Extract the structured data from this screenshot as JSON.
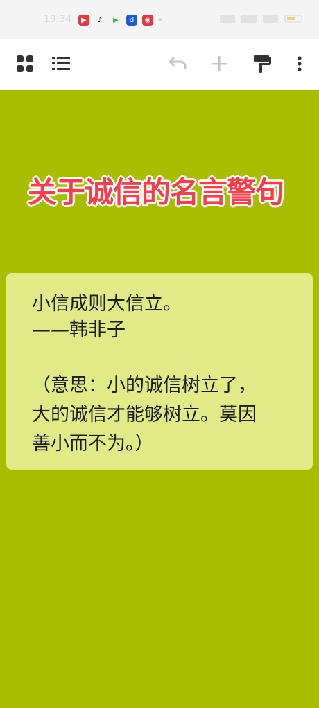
{
  "status_bar": {
    "time": "19:34",
    "apps": [
      {
        "name": "video-app-icon",
        "color": "#e43a3a",
        "glyph": "▶"
      },
      {
        "name": "douyin-icon",
        "color": "#ffffff",
        "glyph": "♪"
      },
      {
        "name": "tencent-video-icon",
        "color": "#ffffff",
        "glyph": "▶"
      },
      {
        "name": "notes-app-icon",
        "color": "#1d5fd0",
        "glyph": "d"
      },
      {
        "name": "weibo-icon",
        "color": "#e8373d",
        "glyph": "◉"
      }
    ]
  },
  "toolbar": {
    "icons": [
      "grid-view-icon",
      "list-view-icon",
      "undo-icon",
      "add-icon",
      "paint-roller-icon",
      "more-vert-icon"
    ]
  },
  "canvas": {
    "background": "#a8bc00",
    "headline": "关于诚信的名言警句",
    "headline_color": "#f73e49",
    "card": {
      "background": "#e0ea87",
      "quote": "小信成则大信立。",
      "author": "——韩非子",
      "meaning_line1": "（意思：小的诚信树立了，",
      "meaning_line2": "大的诚信才能够树立。莫因",
      "meaning_line3": "善小而不为。）"
    }
  }
}
